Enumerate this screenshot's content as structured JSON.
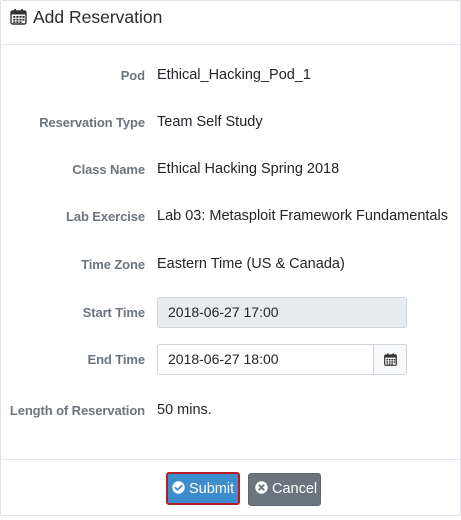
{
  "header": {
    "title": "Add Reservation",
    "icon": "calendar-icon"
  },
  "form": {
    "pod": {
      "label": "Pod",
      "value": "Ethical_Hacking_Pod_1"
    },
    "reservation_type": {
      "label": "Reservation Type",
      "value": "Team Self Study"
    },
    "class_name": {
      "label": "Class Name",
      "value": "Ethical Hacking Spring 2018"
    },
    "lab_exercise": {
      "label": "Lab Exercise",
      "value": "Lab 03: Metasploit Framework Fundamentals"
    },
    "time_zone": {
      "label": "Time Zone",
      "value": "Eastern Time (US & Canada)"
    },
    "start_time": {
      "label": "Start Time",
      "value": "2018-06-27 17:00"
    },
    "end_time": {
      "label": "End Time",
      "value": "2018-06-27 18:00",
      "picker_icon": "calendar-icon"
    },
    "length": {
      "label": "Length of Reservation",
      "value": "50 mins."
    }
  },
  "footer": {
    "submit_label": "Submit",
    "submit_icon": "check-circle-icon",
    "cancel_label": "Cancel",
    "cancel_icon": "times-circle-icon"
  },
  "colors": {
    "submit_bg": "#3c8dcb",
    "submit_focus_border": "#b51c25",
    "cancel_bg": "#6c757d",
    "label_text": "#6c757d",
    "readonly_bg": "#e9ecef"
  }
}
